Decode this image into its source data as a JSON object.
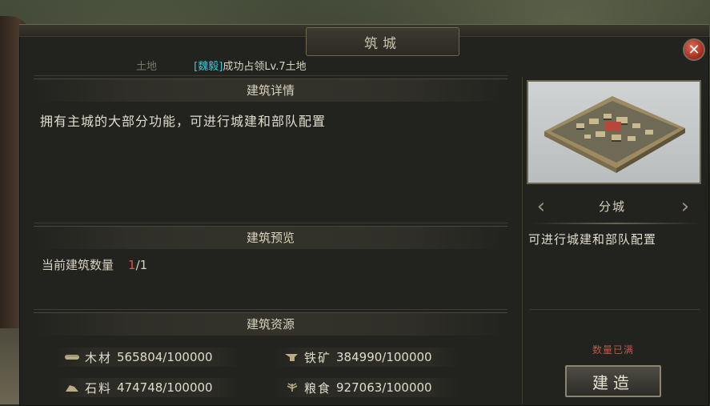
{
  "window": {
    "title": "筑城",
    "close_symbol": "✕"
  },
  "land": {
    "label": "土地",
    "tag": "[魏毅]",
    "status": "成功占领Lv.7土地"
  },
  "details": {
    "section_title": "建筑详情",
    "description": "拥有主城的大部分功能，可进行城建和部队配置"
  },
  "preview": {
    "section_title": "建筑预览",
    "count_label": "当前建筑数量",
    "count_current": "1",
    "count_total": "/1"
  },
  "resources": {
    "section_title": "建筑资源",
    "items": [
      {
        "name": "木材",
        "value": "565804/100000",
        "icon": "wood-icon"
      },
      {
        "name": "铁矿",
        "value": "384990/100000",
        "icon": "iron-icon"
      },
      {
        "name": "石料",
        "value": "474748/100000",
        "icon": "stone-icon"
      },
      {
        "name": "粮食",
        "value": "927063/100000",
        "icon": "grain-icon"
      }
    ]
  },
  "building": {
    "variant_name": "分城",
    "variant_desc": "可进行城建和部队配置",
    "status_note": "数量已满",
    "build_label": "建造",
    "prev_arrow": "‹",
    "next_arrow": "›"
  }
}
